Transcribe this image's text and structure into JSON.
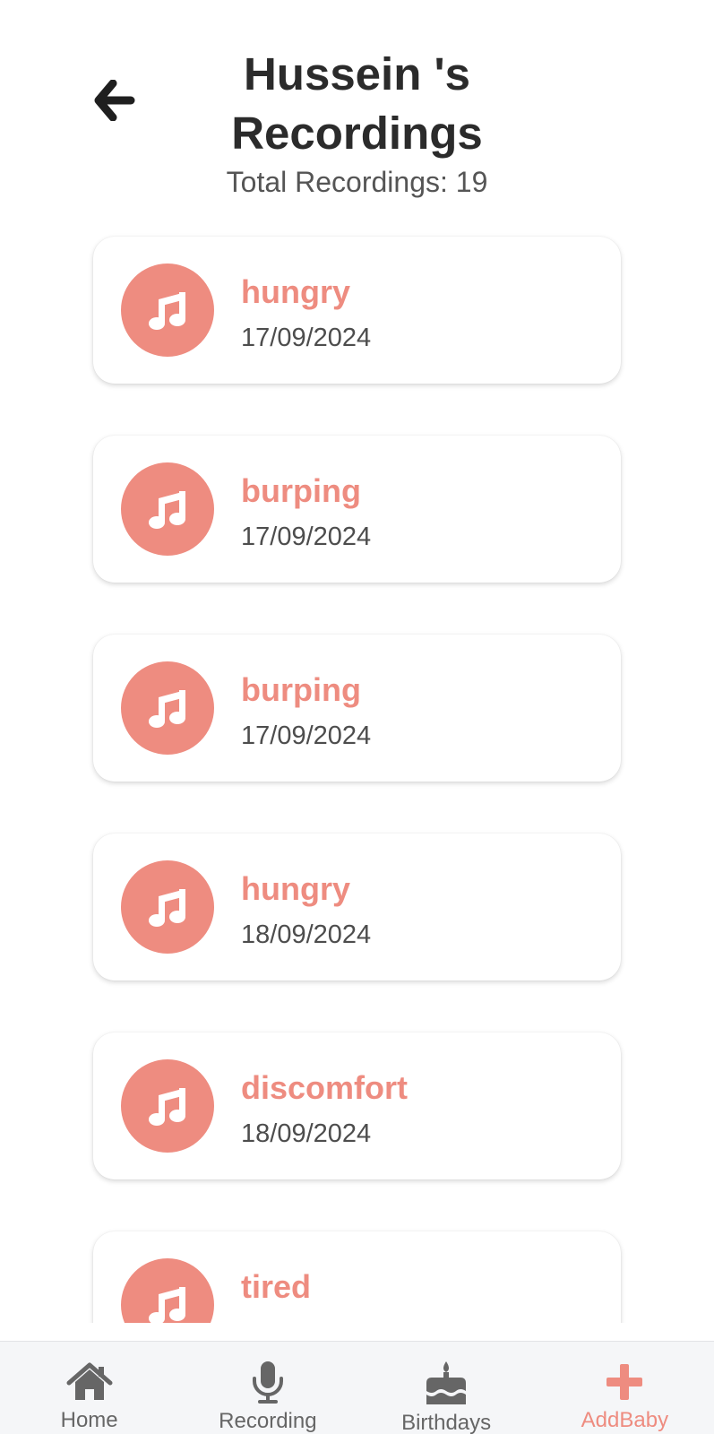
{
  "header": {
    "title_line1": "Hussein 's",
    "title_line2": "Recordings",
    "total_label": "Total Recordings: 19",
    "back_icon": "arrow-left-icon"
  },
  "recordings": [
    {
      "label": "hungry",
      "date": "17/09/2024"
    },
    {
      "label": "burping",
      "date": "17/09/2024"
    },
    {
      "label": "burping",
      "date": "17/09/2024"
    },
    {
      "label": "hungry",
      "date": "18/09/2024"
    },
    {
      "label": "discomfort",
      "date": "18/09/2024"
    },
    {
      "label": "tired",
      "date": ""
    }
  ],
  "nav": {
    "items": [
      {
        "label": "Home",
        "icon": "home-icon"
      },
      {
        "label": "Recording",
        "icon": "microphone-icon"
      },
      {
        "label": "Birthdays",
        "icon": "cake-icon"
      },
      {
        "label": "AddBaby",
        "icon": "plus-icon",
        "active": true
      }
    ]
  },
  "colors": {
    "accent": "#ee8c80",
    "title": "#2b2b2b",
    "text_secondary": "#4d4d4d",
    "nav_inactive": "#666666",
    "nav_background": "#f5f6f8"
  }
}
